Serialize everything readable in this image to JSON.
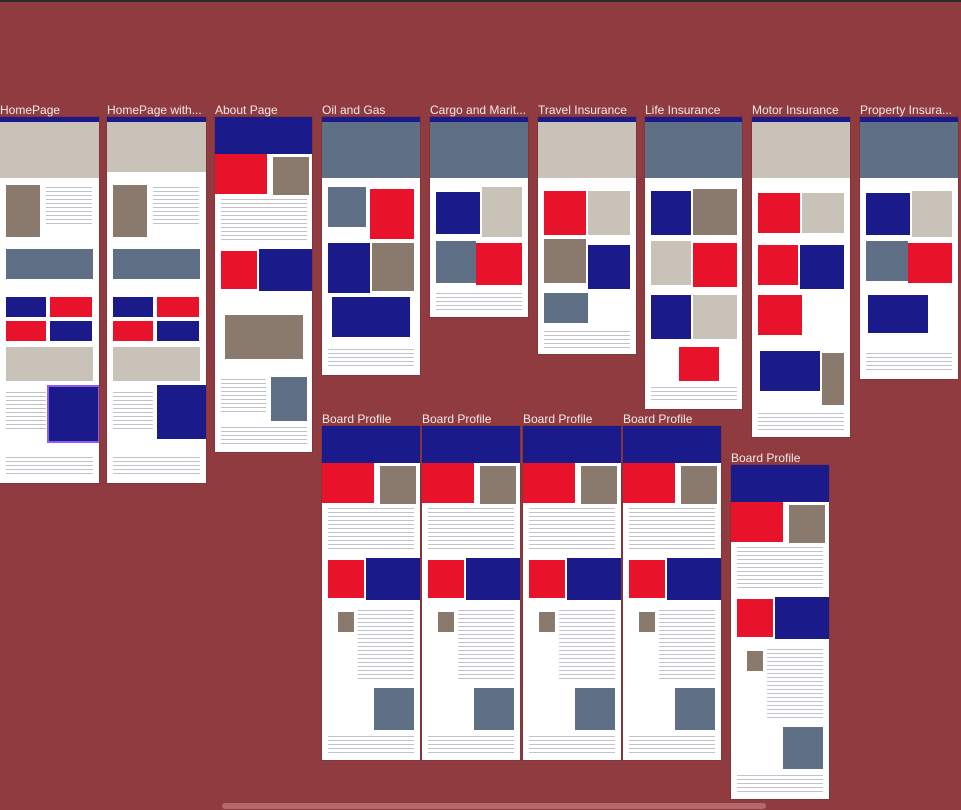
{
  "canvas": {
    "background": "#8f3b3f",
    "accent_navy": "#1a1a8a",
    "accent_red": "#e8132b",
    "selection_color": "#8b5cf6"
  },
  "frames": [
    {
      "label": "HomePage"
    },
    {
      "label": "HomePage with..."
    },
    {
      "label": "About Page"
    },
    {
      "label": "Oil and Gas"
    },
    {
      "label": "Cargo and Marit..."
    },
    {
      "label": "Travel Insurance"
    },
    {
      "label": "Life Insurance"
    },
    {
      "label": "Motor Insurance"
    },
    {
      "label": "Property Insura..."
    },
    {
      "label": "Board Profile"
    },
    {
      "label": "Board Profile"
    },
    {
      "label": "Board Profile"
    },
    {
      "label": "Board Profile"
    },
    {
      "label": "Board Profile"
    }
  ]
}
